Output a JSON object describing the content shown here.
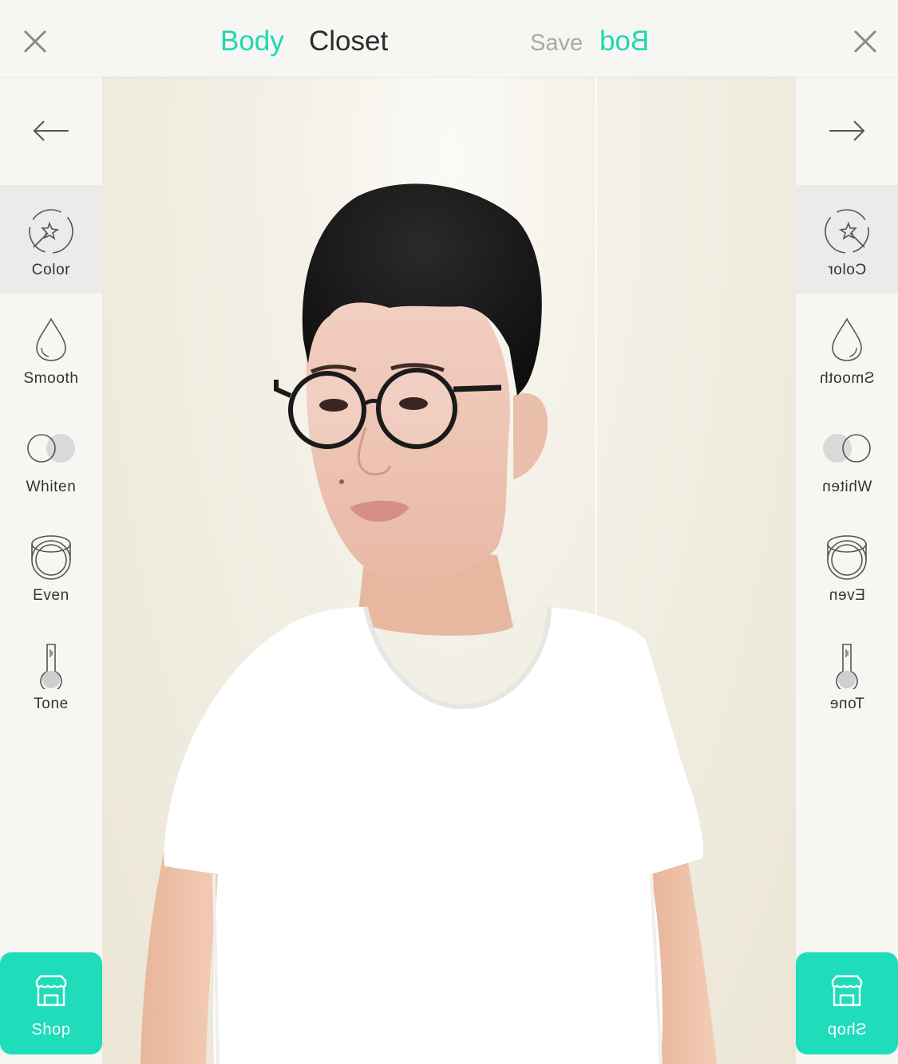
{
  "header": {
    "tab_body": "Body",
    "tab_closet": "Closet",
    "save_label": "Save",
    "mirrored_tab": "Bod"
  },
  "colors": {
    "accent": "#1fd6b3",
    "shop_button": "#1fdcbb",
    "active_tool_bg": "#ebebea"
  },
  "left_panel": {
    "tools": [
      {
        "label": "Color",
        "icon": "color-wand-icon",
        "active": true
      },
      {
        "label": "Smooth",
        "icon": "droplet-icon"
      },
      {
        "label": "Whiten",
        "icon": "whiten-circles-icon"
      },
      {
        "label": "Even",
        "icon": "compact-powder-icon"
      },
      {
        "label": "Tone",
        "icon": "thermometer-icon"
      }
    ],
    "shop_label": "Shop"
  },
  "right_panel": {
    "tools": [
      {
        "label": "Color",
        "icon": "color-wand-icon",
        "active": true
      },
      {
        "label": "Smooth",
        "icon": "droplet-icon"
      },
      {
        "label": "Whiten",
        "icon": "whiten-circles-icon"
      },
      {
        "label": "Even",
        "icon": "compact-powder-icon"
      },
      {
        "label": "Tone",
        "icon": "thermometer-icon"
      }
    ],
    "shop_label": "Shop"
  }
}
